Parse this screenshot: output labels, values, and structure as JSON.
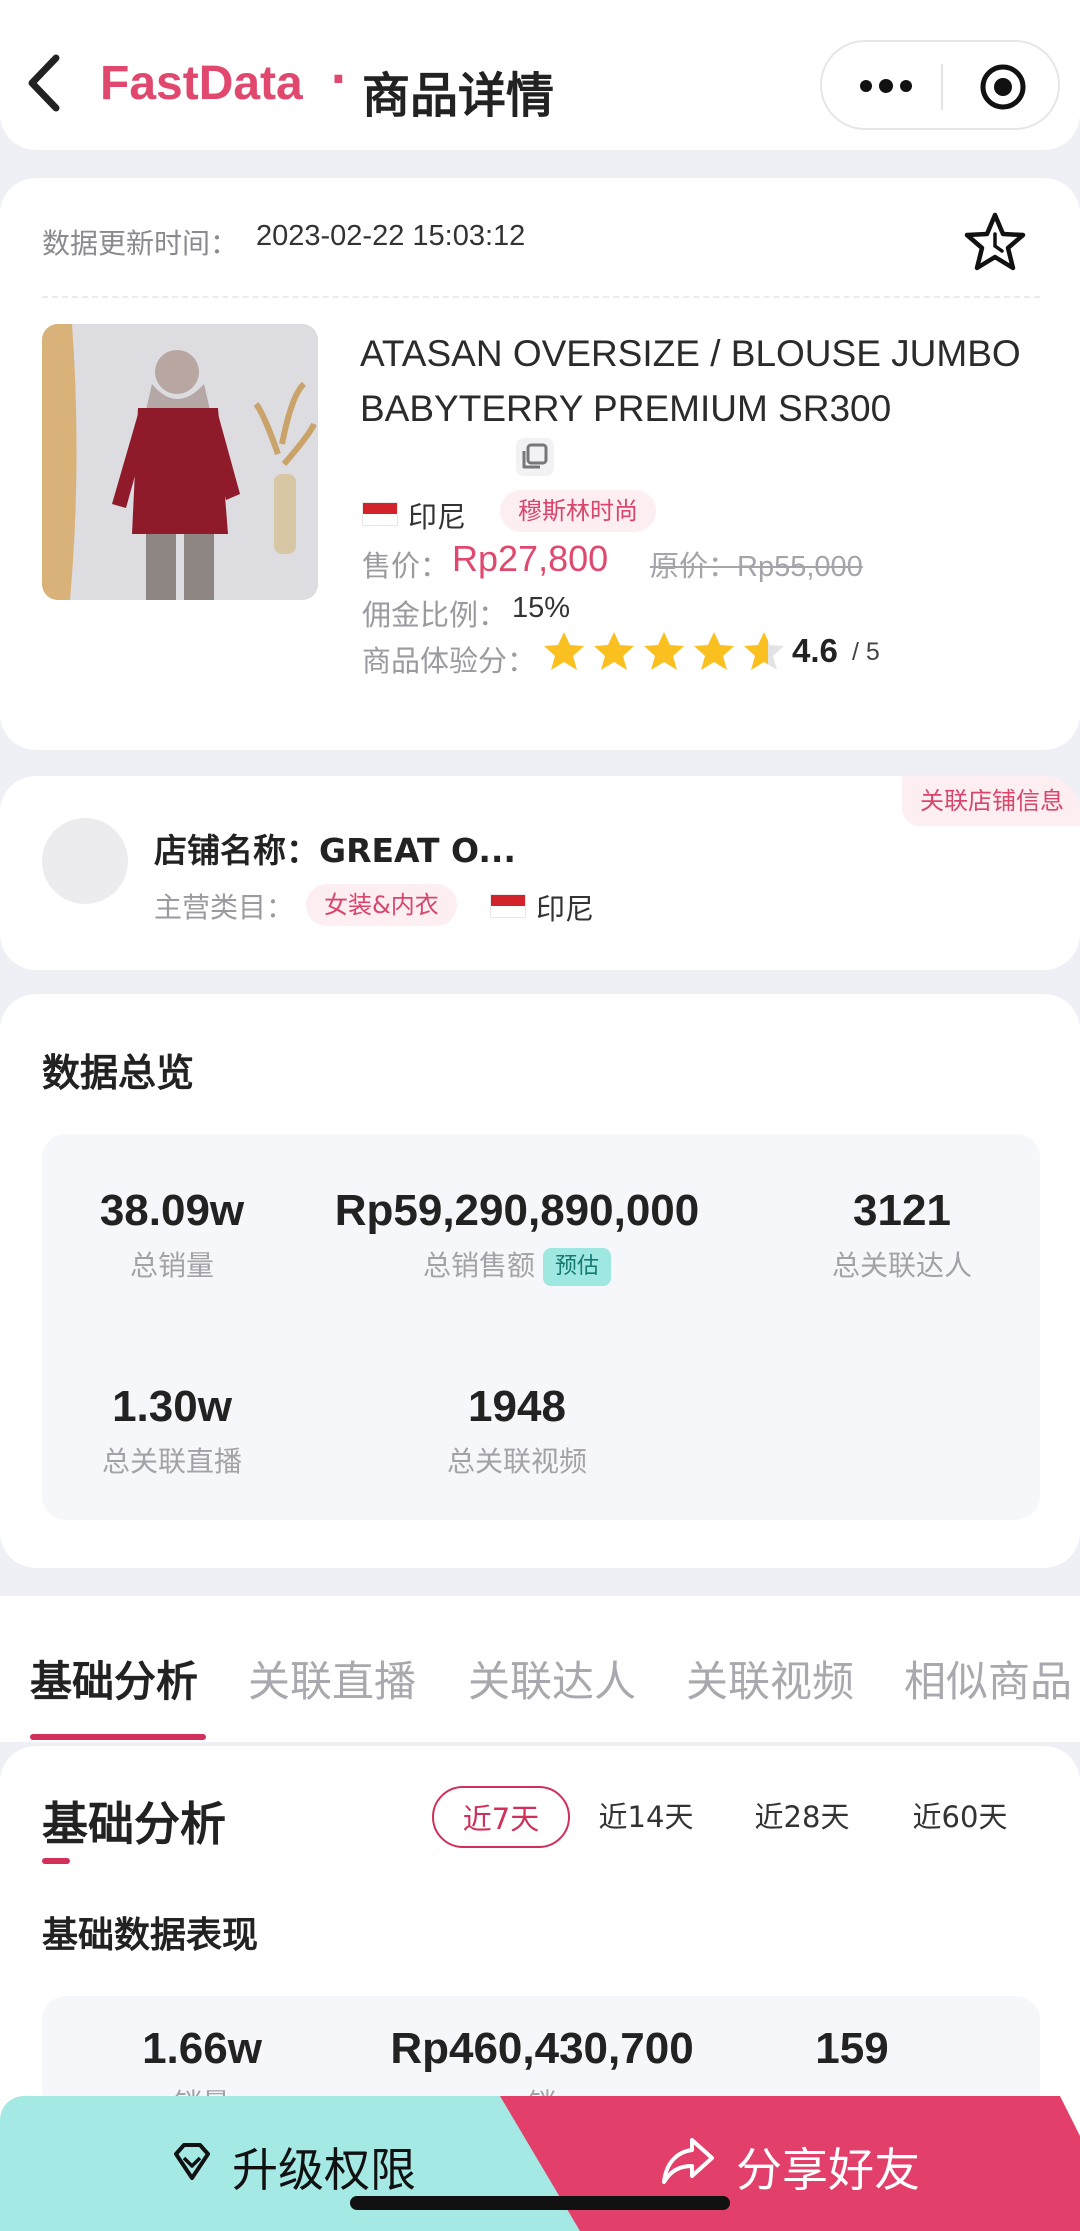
{
  "header": {
    "brand": "FastData",
    "separator": "·",
    "title": "商品详情"
  },
  "product": {
    "update_label": "数据更新时间：",
    "update_time": "2023-02-22 15:03:12",
    "title": "ATASAN OVERSIZE / BLOUSE JUMBO BABYTERRY PREMIUM SR300",
    "country": "印尼",
    "category_tag": "穆斯林时尚",
    "price_label": "售价：",
    "price": "Rp27,800",
    "original_price": "原价：Rp55,000",
    "commission_label": "佣金比例：",
    "commission": "15%",
    "rating_label": "商品体验分：",
    "rating": 4.6,
    "rating_value": "4.6",
    "rating_of": "/ 5"
  },
  "shop": {
    "link_label": "关联店铺信息",
    "name": "店铺名称：GREAT O...",
    "category_label": "主营类目：",
    "category": "女装&内衣",
    "country": "印尼"
  },
  "overview": {
    "title": "数据总览",
    "metrics": [
      {
        "value": "38.09w",
        "caption": "总销量"
      },
      {
        "value": "Rp59,290,890,000",
        "caption": "总销售额",
        "badge": "预估"
      },
      {
        "value": "3121",
        "caption": "总关联达人"
      },
      {
        "value": "1.30w",
        "caption": "总关联直播"
      },
      {
        "value": "1948",
        "caption": "总关联视频"
      }
    ]
  },
  "tabs": [
    "基础分析",
    "关联直播",
    "关联达人",
    "关联视频",
    "相似商品"
  ],
  "analysis": {
    "title": "基础分析",
    "ranges": [
      "近7天",
      "近14天",
      "近28天",
      "近60天"
    ],
    "subtitle": "基础数据表现",
    "metrics": [
      {
        "value": "1.66w",
        "caption": "销量"
      },
      {
        "value": "Rp460,430,700",
        "caption": "销"
      },
      {
        "value": "159"
      }
    ]
  },
  "actions": {
    "upgrade": "升级权限",
    "share": "分享好友"
  },
  "colors": {
    "brand": "#e0486e",
    "accent": "#d0305a",
    "upgrade_bg": "#a4e9e4",
    "share_bg": "#e23f6a",
    "star": "#f9c020"
  },
  "icons": [
    "back-icon",
    "more-icon",
    "target-icon",
    "star-outline-icon",
    "copy-icon",
    "diamond-icon",
    "share-icon"
  ]
}
